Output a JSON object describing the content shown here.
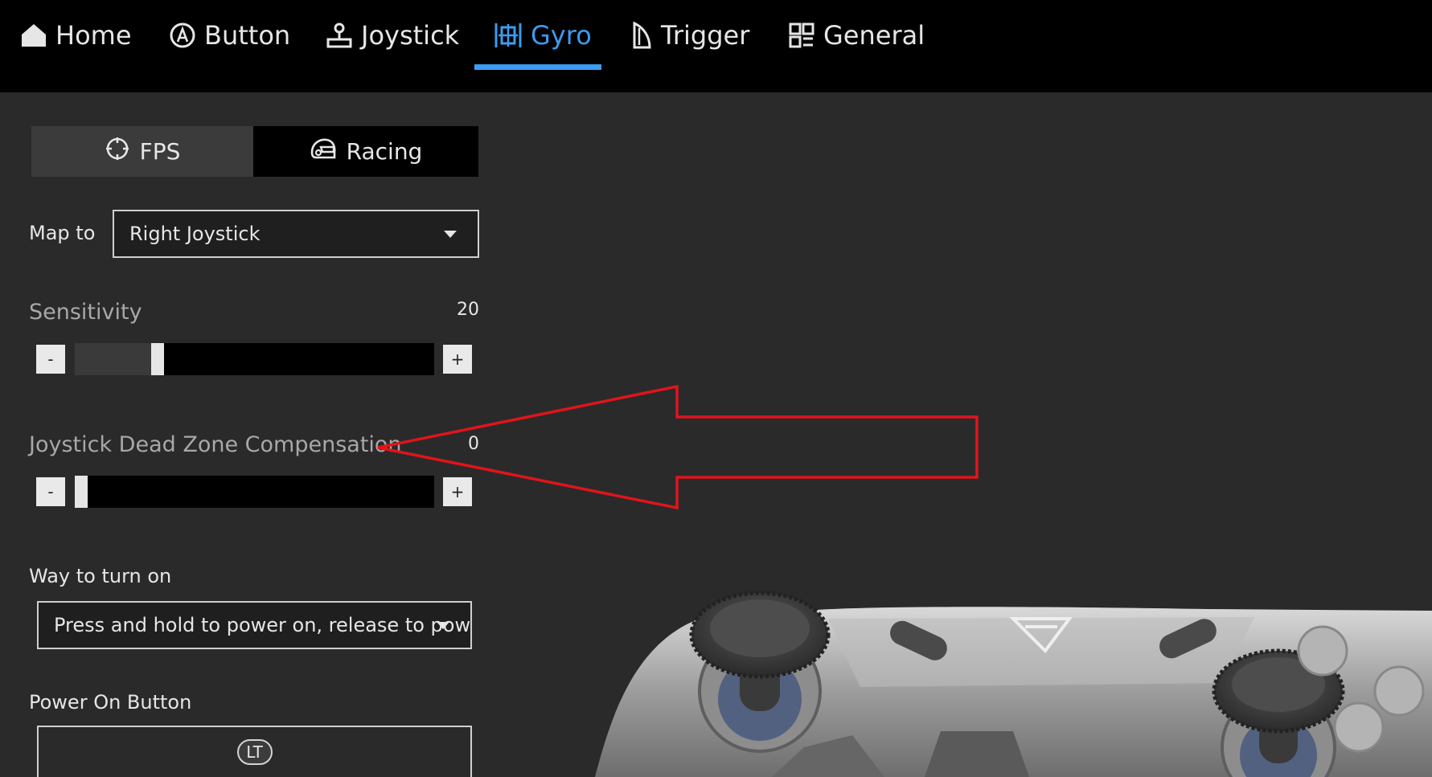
{
  "nav": {
    "items": [
      {
        "label": "Home",
        "icon": "home-icon"
      },
      {
        "label": "Button",
        "icon": "button-a-icon"
      },
      {
        "label": "Joystick",
        "icon": "joystick-icon"
      },
      {
        "label": "Gyro",
        "icon": "gyro-icon",
        "active": true
      },
      {
        "label": "Trigger",
        "icon": "trigger-icon"
      },
      {
        "label": "General",
        "icon": "grid-icon"
      }
    ],
    "accent_color": "#3d9bf0"
  },
  "mode": {
    "fps_label": "FPS",
    "racing_label": "Racing",
    "selected": "Racing"
  },
  "map_to": {
    "label": "Map to",
    "value": "Right Joystick"
  },
  "sensitivity": {
    "label": "Sensitivity",
    "value": "20",
    "fraction": 0.22,
    "minus": "-",
    "plus": "+"
  },
  "dead_zone": {
    "label": "Joystick Dead Zone Compensation",
    "value": "0",
    "fraction": 0.0,
    "minus": "-",
    "plus": "+"
  },
  "turn_on": {
    "label": "Way to turn on",
    "value": "Press and hold to power on, release to pow"
  },
  "power_on_button": {
    "label": "Power On Button",
    "value": "LT"
  },
  "annotation": {
    "color": "#e0141c"
  }
}
